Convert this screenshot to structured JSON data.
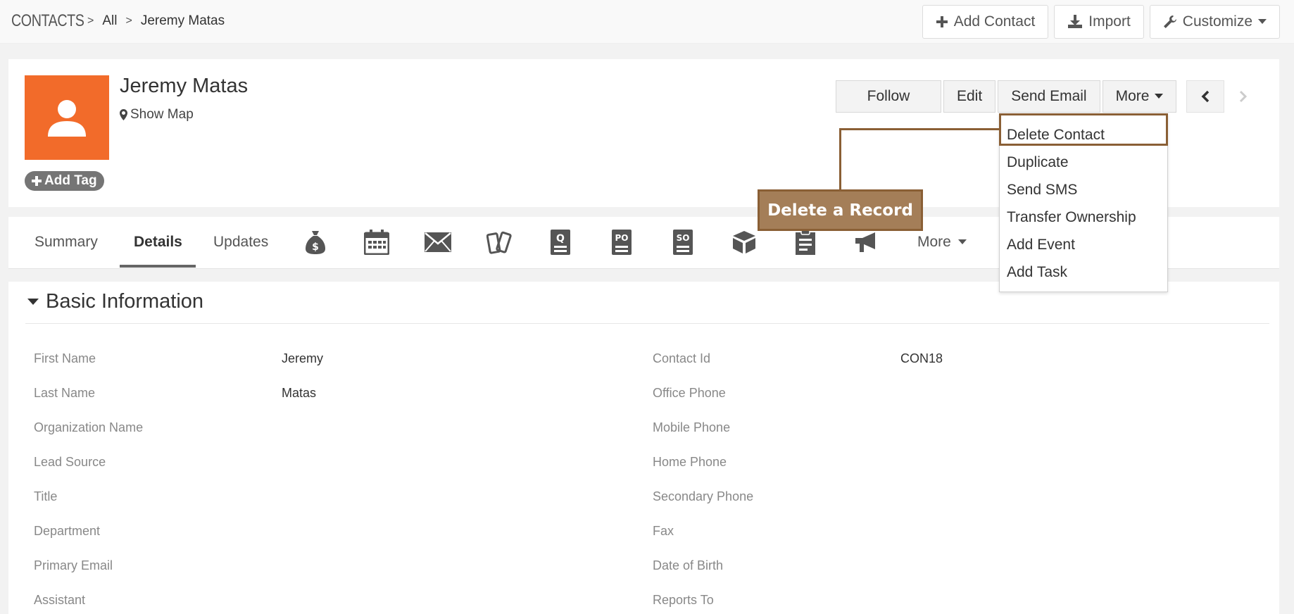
{
  "breadcrumb": {
    "module": "CONTACTS",
    "separator": ">",
    "filter": "All",
    "record": "Jeremy Matas"
  },
  "top_actions": {
    "add_contact": "Add Contact",
    "import": "Import",
    "customize": "Customize"
  },
  "record": {
    "name": "Jeremy Matas",
    "show_map": "Show Map",
    "add_tag": "Add Tag",
    "avatar_color": "#f26b2a"
  },
  "record_actions": {
    "follow": "Follow",
    "edit": "Edit",
    "send_email": "Send Email",
    "more": "More"
  },
  "more_menu": {
    "items": [
      "Delete Contact",
      "Duplicate",
      "Send SMS",
      "Transfer Ownership",
      "Add Event",
      "Add Task"
    ],
    "highlighted": "Delete Contact"
  },
  "callout": {
    "text": "Delete a Record",
    "color": "#a47e58",
    "border_color": "#8a5f35"
  },
  "tabs": {
    "summary": "Summary",
    "details": "Details",
    "updates": "Updates",
    "more": "More",
    "active": "Details",
    "icons": [
      "money-bag-icon",
      "calendar-icon",
      "envelope-icon",
      "tickets-icon",
      "quote-icon",
      "purchase-order-icon",
      "sales-order-icon",
      "box-icon",
      "document-icon",
      "megaphone-icon"
    ]
  },
  "details": {
    "block_title": "Basic Information",
    "left_fields": [
      {
        "label": "First Name",
        "value": "Jeremy"
      },
      {
        "label": "Last Name",
        "value": "Matas"
      },
      {
        "label": "Organization Name",
        "value": ""
      },
      {
        "label": "Lead Source",
        "value": ""
      },
      {
        "label": "Title",
        "value": ""
      },
      {
        "label": "Department",
        "value": ""
      },
      {
        "label": "Primary Email",
        "value": ""
      },
      {
        "label": "Assistant",
        "value": ""
      }
    ],
    "right_fields": [
      {
        "label": "Contact Id",
        "value": "CON18"
      },
      {
        "label": "Office Phone",
        "value": ""
      },
      {
        "label": "Mobile Phone",
        "value": ""
      },
      {
        "label": "Home Phone",
        "value": ""
      },
      {
        "label": "Secondary Phone",
        "value": ""
      },
      {
        "label": "Fax",
        "value": ""
      },
      {
        "label": "Date of Birth",
        "value": ""
      },
      {
        "label": "Reports To",
        "value": ""
      }
    ]
  }
}
